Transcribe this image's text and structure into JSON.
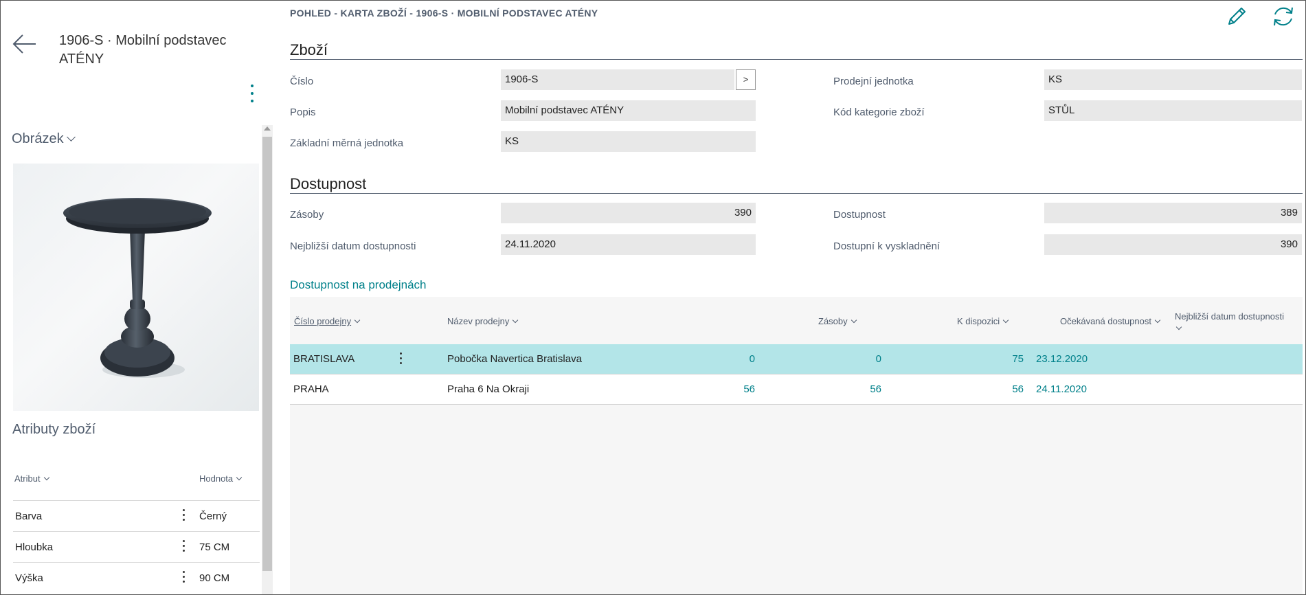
{
  "page": {
    "title": "1906-S · Mobilní podstavec ATÉNY",
    "breadcrumb": "POHLED - KARTA ZBOŽÍ - 1906-S · MOBILNÍ PODSTAVEC ATÉNY"
  },
  "actions": {
    "edit_icon": "pencil-icon",
    "refresh_icon": "refresh-icon",
    "back_icon": "back-arrow-icon"
  },
  "factbox": {
    "picture_heading": "Obrázek",
    "attributes_heading": "Atributy zboží",
    "columns": {
      "attribute": "Atribut",
      "value": "Hodnota"
    },
    "rows": [
      {
        "attribute": "Barva",
        "value": "Černý"
      },
      {
        "attribute": "Hloubka",
        "value": "75 CM"
      },
      {
        "attribute": "Výška",
        "value": "90 CM"
      }
    ]
  },
  "item": {
    "heading": "Zboží",
    "number": {
      "label": "Číslo",
      "value": "1906-S",
      "lookup": ">"
    },
    "description": {
      "label": "Popis",
      "value": "Mobilní podstavec ATÉNY"
    },
    "base_uom": {
      "label": "Základní měrná jednotka",
      "value": "KS"
    },
    "sales_uom": {
      "label": "Prodejní jednotka",
      "value": "KS"
    },
    "category": {
      "label": "Kód kategorie zboží",
      "value": "STŮL"
    }
  },
  "availability": {
    "heading": "Dostupnost",
    "inventory": {
      "label": "Zásoby",
      "value": "390"
    },
    "earliest_date": {
      "label": "Nejbližší datum dostupnosti",
      "value": "24.11.2020"
    },
    "available": {
      "label": "Dostupnost",
      "value": "389"
    },
    "available_to_pick": {
      "label": "Dostupní k vyskladnění",
      "value": "390"
    }
  },
  "stores": {
    "heading": "Dostupnost na prodejnách",
    "columns": {
      "code": "Číslo prodejny",
      "name": "Název prodejny",
      "inventory": "Zásoby",
      "available": "K dispozici",
      "expected": "Očekávaná dostupnost",
      "date": "Nejbližší datum dostupnosti"
    },
    "rows": [
      {
        "code": "BRATISLAVA",
        "name": "Pobočka Navertica Bratislava",
        "inventory": "0",
        "available": "0",
        "expected": "75",
        "date": "23.12.2020"
      },
      {
        "code": "PRAHA",
        "name": "Praha 6 Na Okraji",
        "inventory": "56",
        "available": "56",
        "expected": "56",
        "date": "24.11.2020"
      }
    ]
  },
  "colors": {
    "accent": "#00808a",
    "selected_row": "#b3e5e8",
    "field_bg": "#e8e8e8",
    "label": "#505c6d"
  }
}
